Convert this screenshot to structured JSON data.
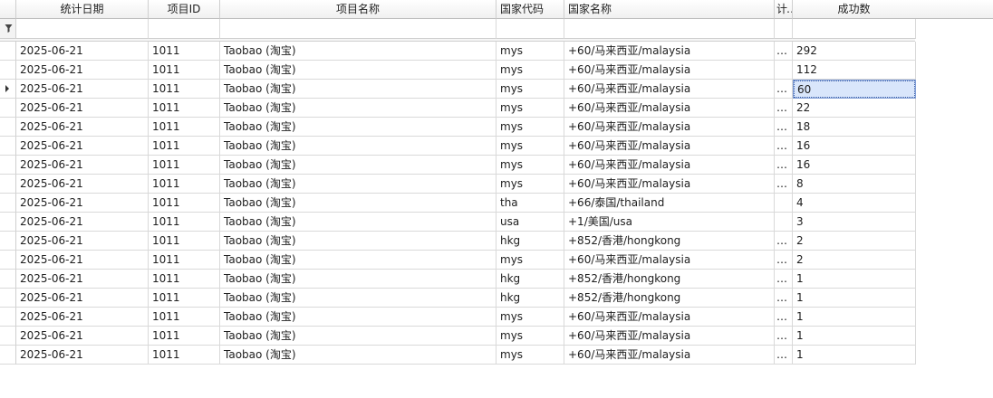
{
  "columns": [
    "",
    "统计日期",
    "项目ID",
    "项目名称",
    "国家代码",
    "国家名称",
    "计…",
    "成功数"
  ],
  "rows": [
    {
      "date": "2025-06-21",
      "pid": "1011",
      "pname": "Taobao (淘宝)",
      "code": "mys",
      "country": "+60/马来西亚/malaysia",
      "extra": "…",
      "count": "292"
    },
    {
      "date": "2025-06-21",
      "pid": "1011",
      "pname": "Taobao (淘宝)",
      "code": "mys",
      "country": "+60/马来西亚/malaysia",
      "extra": "",
      "count": "112"
    },
    {
      "date": "2025-06-21",
      "pid": "1011",
      "pname": "Taobao (淘宝)",
      "code": "mys",
      "country": "+60/马来西亚/malaysia",
      "extra": "…",
      "count": "60"
    },
    {
      "date": "2025-06-21",
      "pid": "1011",
      "pname": "Taobao (淘宝)",
      "code": "mys",
      "country": "+60/马来西亚/malaysia",
      "extra": "…",
      "count": "22"
    },
    {
      "date": "2025-06-21",
      "pid": "1011",
      "pname": "Taobao (淘宝)",
      "code": "mys",
      "country": "+60/马来西亚/malaysia",
      "extra": "…",
      "count": "18"
    },
    {
      "date": "2025-06-21",
      "pid": "1011",
      "pname": "Taobao (淘宝)",
      "code": "mys",
      "country": "+60/马来西亚/malaysia",
      "extra": "…",
      "count": "16"
    },
    {
      "date": "2025-06-21",
      "pid": "1011",
      "pname": "Taobao (淘宝)",
      "code": "mys",
      "country": "+60/马来西亚/malaysia",
      "extra": "…",
      "count": "16"
    },
    {
      "date": "2025-06-21",
      "pid": "1011",
      "pname": "Taobao (淘宝)",
      "code": "mys",
      "country": "+60/马来西亚/malaysia",
      "extra": "…",
      "count": "8"
    },
    {
      "date": "2025-06-21",
      "pid": "1011",
      "pname": "Taobao (淘宝)",
      "code": "tha",
      "country": "+66/泰国/thailand",
      "extra": "",
      "count": "4"
    },
    {
      "date": "2025-06-21",
      "pid": "1011",
      "pname": "Taobao (淘宝)",
      "code": "usa",
      "country": "+1/美国/usa",
      "extra": "",
      "count": "3"
    },
    {
      "date": "2025-06-21",
      "pid": "1011",
      "pname": "Taobao (淘宝)",
      "code": "hkg",
      "country": "+852/香港/hongkong",
      "extra": "…",
      "count": "2"
    },
    {
      "date": "2025-06-21",
      "pid": "1011",
      "pname": "Taobao (淘宝)",
      "code": "mys",
      "country": "+60/马来西亚/malaysia",
      "extra": "…",
      "count": "2"
    },
    {
      "date": "2025-06-21",
      "pid": "1011",
      "pname": "Taobao (淘宝)",
      "code": "hkg",
      "country": "+852/香港/hongkong",
      "extra": "…",
      "count": "1"
    },
    {
      "date": "2025-06-21",
      "pid": "1011",
      "pname": "Taobao (淘宝)",
      "code": "hkg",
      "country": "+852/香港/hongkong",
      "extra": "…",
      "count": "1"
    },
    {
      "date": "2025-06-21",
      "pid": "1011",
      "pname": "Taobao (淘宝)",
      "code": "mys",
      "country": "+60/马来西亚/malaysia",
      "extra": "…",
      "count": "1"
    },
    {
      "date": "2025-06-21",
      "pid": "1011",
      "pname": "Taobao (淘宝)",
      "code": "mys",
      "country": "+60/马来西亚/malaysia",
      "extra": "…",
      "count": "1"
    },
    {
      "date": "2025-06-21",
      "pid": "1011",
      "pname": "Taobao (淘宝)",
      "code": "mys",
      "country": "+60/马来西亚/malaysia",
      "extra": "…",
      "count": "1"
    }
  ],
  "current_row": 2,
  "icons": {
    "filter": "filter-icon",
    "row_indicator": "current-row-arrow-icon"
  }
}
